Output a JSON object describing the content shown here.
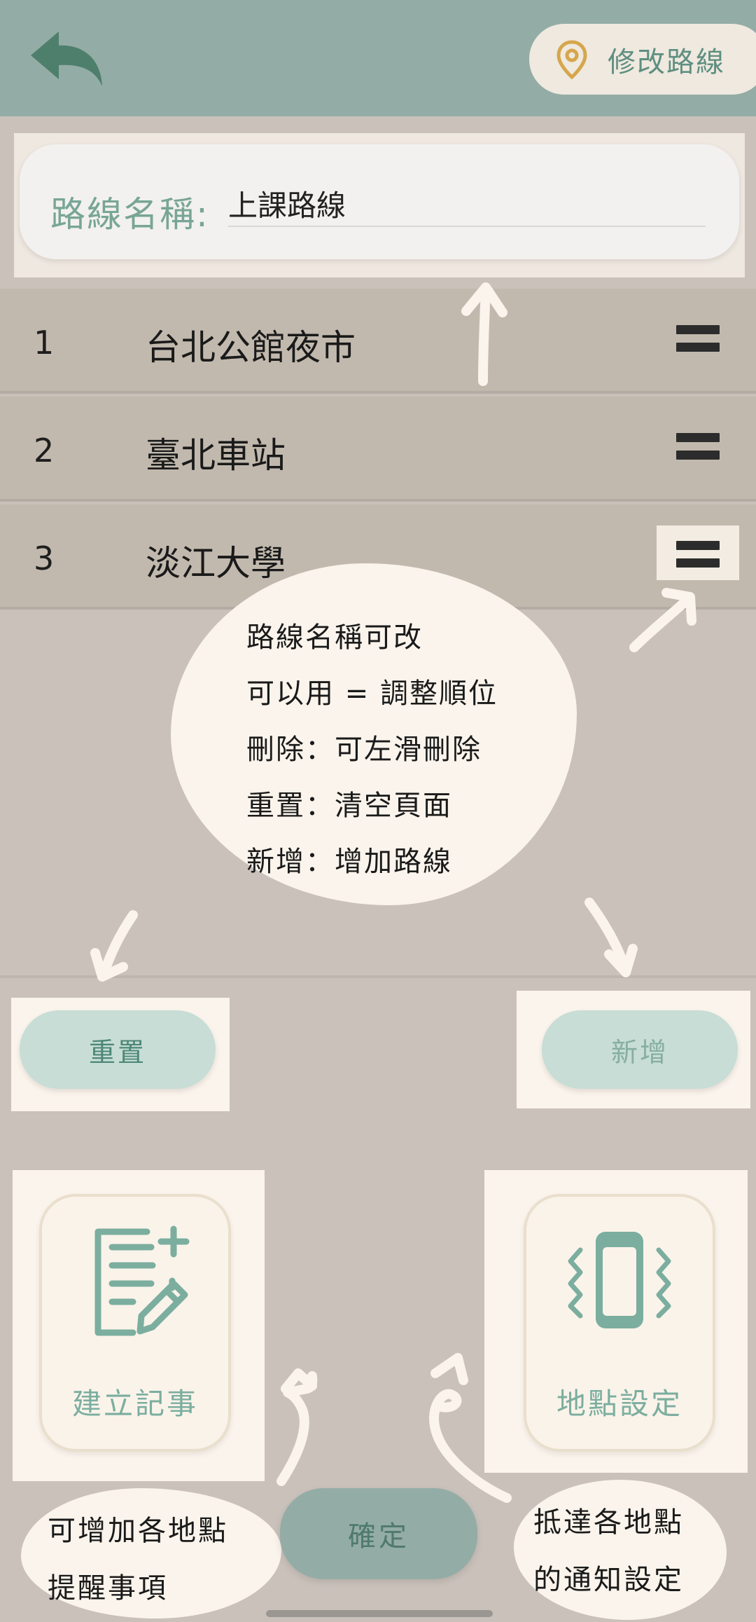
{
  "header": {
    "back_icon": "back-arrow-icon",
    "edit_route_icon": "location-pin-icon",
    "edit_route_label": "修改路線"
  },
  "route_name": {
    "label": "路線名稱:",
    "value": "上課路線"
  },
  "route_stops": [
    {
      "index": "1",
      "name": "台北公館夜市"
    },
    {
      "index": "2",
      "name": "臺北車站"
    },
    {
      "index": "3",
      "name": "淡江大學"
    }
  ],
  "annotations": {
    "main_bubble": [
      "路線名稱可改",
      "可以用 = 調整順位",
      "刪除：可左滑刪除",
      "重置：清空頁面",
      "新增：增加路線"
    ],
    "left_bubble": [
      "可增加各地點",
      "提醒事項"
    ],
    "right_bubble": [
      "抵達各地點",
      "的通知設定"
    ]
  },
  "actions": {
    "reset_label": "重置",
    "add_label": "新增",
    "confirm_label": "確定"
  },
  "features": {
    "note": {
      "label": "建立記事",
      "icon": "note-add-icon"
    },
    "location": {
      "label": "地點設定",
      "icon": "phone-vibrate-icon"
    }
  },
  "colors": {
    "header": "#94aca6",
    "accent": "#5f8f81",
    "row": "#c2b9ae",
    "background": "#c9c1ba"
  }
}
